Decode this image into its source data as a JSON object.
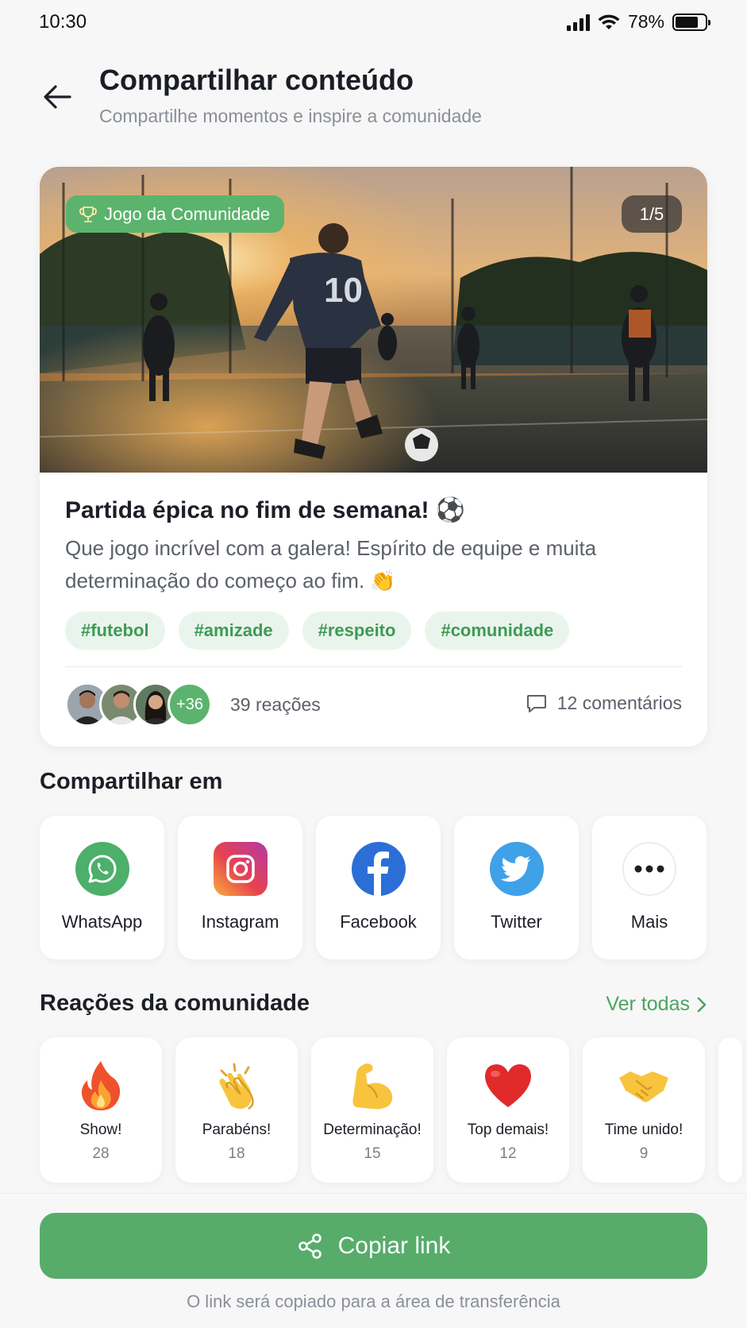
{
  "status_bar": {
    "time": "10:30",
    "battery": "78%"
  },
  "header": {
    "title": "Compartilhar conteúdo",
    "subtitle": "Compartilhe momentos e inspire a comunidade"
  },
  "post": {
    "badge": "Jogo da Comunidade",
    "counter": "1/5",
    "jersey_number": "10",
    "title": "Partida épica no fim de semana! ⚽",
    "description": "Que jogo incrível com a galera! Espírito de equipe e muita determinação do começo ao fim. 👏",
    "tags": [
      "#futebol",
      "#amizade",
      "#respeito",
      "#comunidade"
    ],
    "avatars_more": "+36",
    "reactions": "39 reações",
    "comments": "12 comentários"
  },
  "share": {
    "title": "Compartilhar em",
    "items": [
      {
        "label": "WhatsApp",
        "icon": "whatsapp-icon",
        "color": "#4caf6a"
      },
      {
        "label": "Instagram",
        "icon": "instagram-icon",
        "color": "#d6336c"
      },
      {
        "label": "Facebook",
        "icon": "facebook-icon",
        "color": "#2b6fd6"
      },
      {
        "label": "Twitter",
        "icon": "twitter-icon",
        "color": "#3fa1e8"
      },
      {
        "label": "Mais",
        "icon": "more-icon",
        "color": "#1c1f26"
      }
    ]
  },
  "reactions": {
    "title": "Reações da comunidade",
    "see_all": "Ver todas",
    "items": [
      {
        "emoji": "🔥",
        "label": "Show!",
        "count": "28"
      },
      {
        "emoji": "👏",
        "label": "Parabéns!",
        "count": "18"
      },
      {
        "emoji": "💪",
        "label": "Determinação!",
        "count": "15"
      },
      {
        "emoji": "❤️",
        "label": "Top demais!",
        "count": "12"
      },
      {
        "emoji": "🤝",
        "label": "Time unido!",
        "count": "9"
      }
    ]
  },
  "footer": {
    "button": "Copiar link",
    "hint": "O link será copiado para a área de transferência"
  },
  "colors": {
    "accent": "#57ac6a",
    "tag_bg": "#e9f5ec",
    "tag_text": "#3f9a55"
  }
}
